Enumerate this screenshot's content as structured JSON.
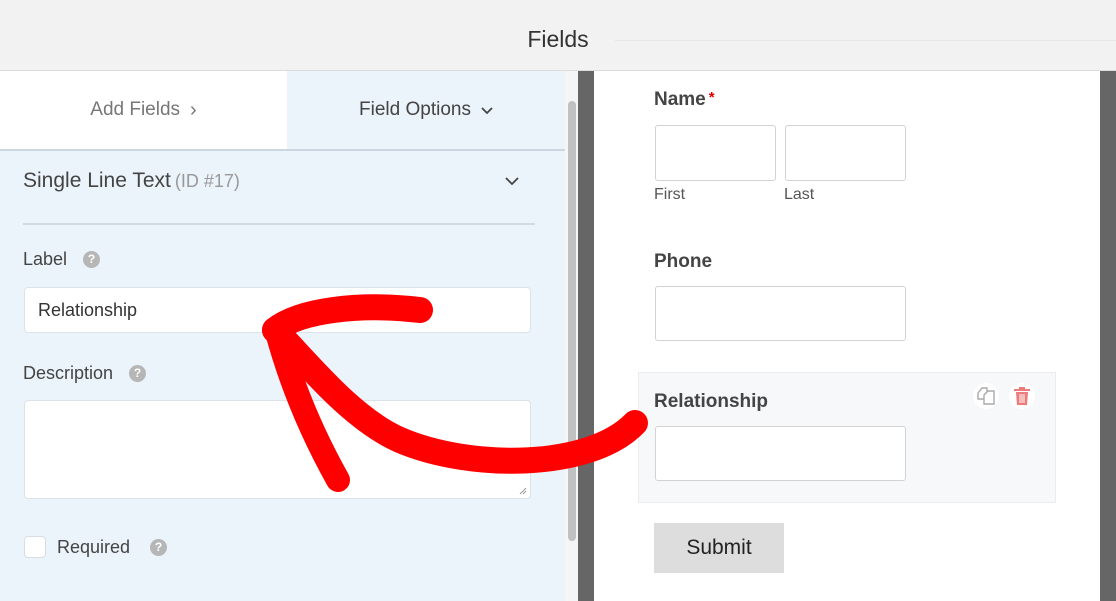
{
  "header": {
    "title": "Fields"
  },
  "tabs": [
    {
      "label": "Add Fields",
      "icon": "chevron-right-icon",
      "glyph": "›",
      "active": false
    },
    {
      "label": "Field Options",
      "icon": "chevron-down-icon",
      "glyph": "⌄",
      "active": true
    }
  ],
  "field_options": {
    "field_type": "Single Line Text",
    "field_id": "(ID #17)",
    "label_label": "Label",
    "label_value": "Relationship",
    "description_label": "Description",
    "description_value": "",
    "required_label": "Required",
    "required_checked": false,
    "help_glyph": "?"
  },
  "preview": {
    "name": {
      "label": "Name",
      "required_mark": "*",
      "first_label": "First",
      "last_label": "Last"
    },
    "phone": {
      "label": "Phone"
    },
    "relationship": {
      "label": "Relationship"
    },
    "submit_label": "Submit"
  },
  "annotation": {
    "type": "curved-arrow",
    "color": "#ff0000",
    "from": "preview relationship field",
    "to": "label input"
  }
}
